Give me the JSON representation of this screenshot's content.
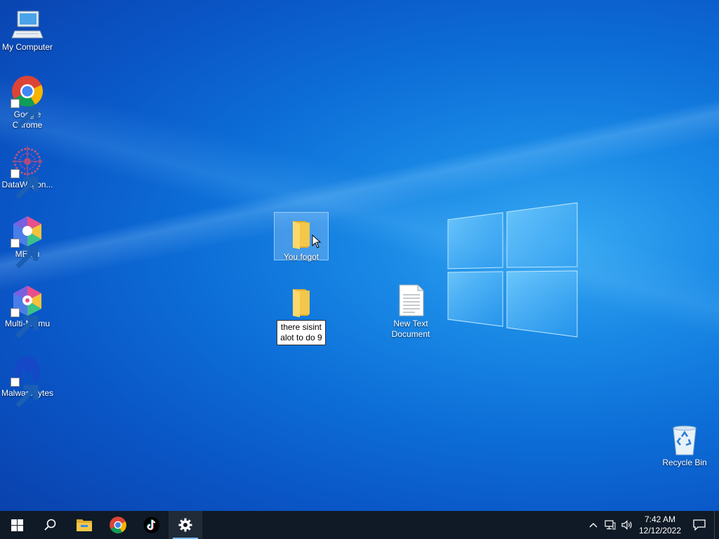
{
  "desktop": {
    "icons": [
      {
        "label": "My Computer",
        "icon": "monitor-icon"
      },
      {
        "label": "Google Chrome",
        "icon": "chrome-icon"
      },
      {
        "label": "DataWagon...",
        "icon": "datawagon-icon"
      },
      {
        "label": "MEmu",
        "icon": "memu-icon"
      },
      {
        "label": "Multi-MEmu",
        "icon": "multi-memu-icon"
      },
      {
        "label": "Malwarebytes",
        "icon": "malwarebytes-icon"
      },
      {
        "label": "You fogot",
        "icon": "folder-icon"
      },
      {
        "label": "there sisint alot to do 9",
        "icon": "folder-icon"
      },
      {
        "label": "New Text Document",
        "icon": "text-document-icon"
      },
      {
        "label": "Recycle Bin",
        "icon": "recycle-bin-icon"
      }
    ]
  },
  "taskbar": {
    "apps": [
      "start-icon",
      "search-icon",
      "file-explorer-icon",
      "chrome-icon",
      "tiktok-icon",
      "settings-icon"
    ],
    "clock": {
      "time": "7:42 AM",
      "date": "12/12/2022"
    }
  },
  "colors": {
    "taskbar": "#0f1a26",
    "desktop": "#0a6fd8",
    "folder": "#f4c74a"
  }
}
